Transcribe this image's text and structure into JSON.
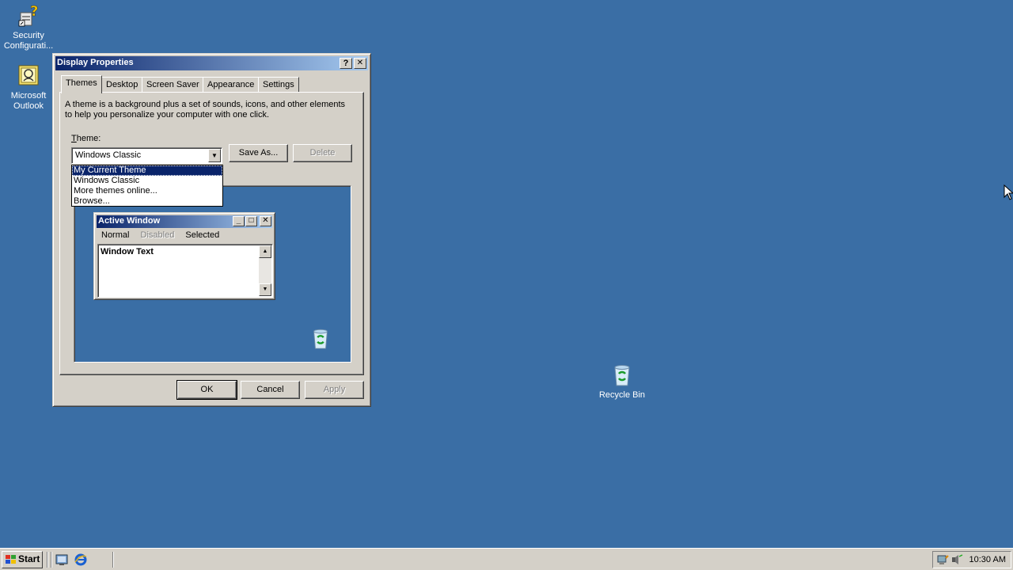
{
  "desktop": {
    "background": "#3a6ea5",
    "icons": [
      {
        "label": "Security Configurati...",
        "icon": "security-config-icon"
      },
      {
        "label": "Microsoft Outlook",
        "icon": "outlook-icon"
      },
      {
        "label": "Recycle Bin",
        "icon": "recycle-bin-icon"
      }
    ]
  },
  "dialog": {
    "title": "Display Properties",
    "help_btn": "?",
    "close_btn": "✕",
    "tabs": [
      {
        "label": "Themes",
        "active": true
      },
      {
        "label": "Desktop"
      },
      {
        "label": "Screen Saver"
      },
      {
        "label": "Appearance"
      },
      {
        "label": "Settings"
      }
    ],
    "description": "A theme is a background plus a set of sounds, icons, and other elements to help you personalize your computer with one click.",
    "theme_label": "Theme:",
    "theme_value": "Windows Classic",
    "theme_options": [
      {
        "label": "My Current Theme",
        "selected": true
      },
      {
        "label": "Windows Classic"
      },
      {
        "label": "More themes online..."
      },
      {
        "label": "Browse..."
      }
    ],
    "save_as": "Save As...",
    "delete": "Delete",
    "preview": {
      "window_title": "Active Window",
      "menu": [
        {
          "label": "Normal"
        },
        {
          "label": "Disabled",
          "disabled": true
        },
        {
          "label": "Selected"
        }
      ],
      "window_text": "Window Text"
    },
    "ok": "OK",
    "cancel": "Cancel",
    "apply": "Apply"
  },
  "taskbar": {
    "start_label": "Start",
    "clock": "10:30 AM",
    "quick_launch": [
      "show-desktop-icon",
      "internet-explorer-icon"
    ],
    "tray_icons": [
      "network-icon",
      "volume-icon"
    ]
  },
  "colors": {
    "titlebar_start": "#0a246a",
    "titlebar_end": "#a6caf0",
    "face": "#d4d0c8"
  }
}
